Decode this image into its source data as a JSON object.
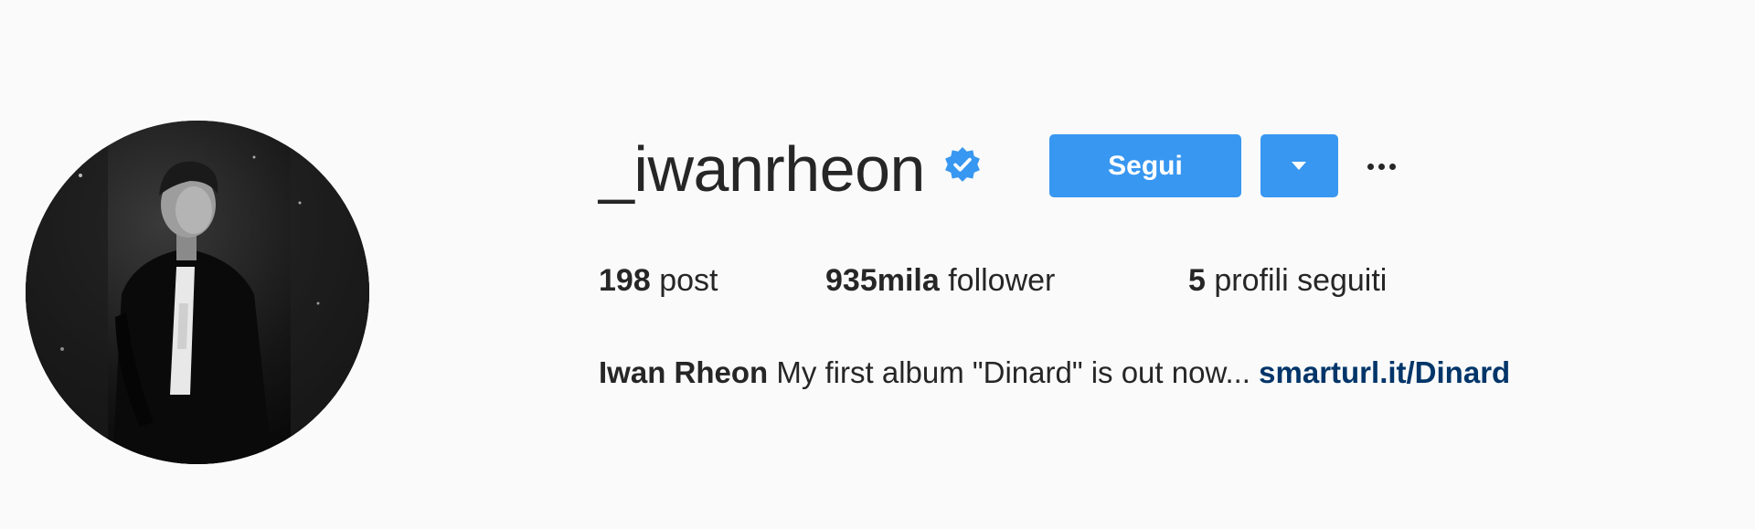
{
  "profile": {
    "username": "_iwanrheon",
    "verified": true,
    "avatar_icon": "profile-photo",
    "accent_color": "#3897f0"
  },
  "actions": {
    "follow_label": "Segui",
    "dropdown_icon": "chevron-down-icon",
    "more_icon": "more-dots-icon"
  },
  "stats": [
    {
      "number": "198",
      "label": "post"
    },
    {
      "number": "935mila",
      "label": "follower"
    },
    {
      "number": "5",
      "label": "profili seguiti"
    }
  ],
  "bio": {
    "full_name": "Iwan Rheon",
    "text": "My first album \"Dinard\" is out now...",
    "link": "smarturl.it/Dinard",
    "link_color": "#003569"
  }
}
